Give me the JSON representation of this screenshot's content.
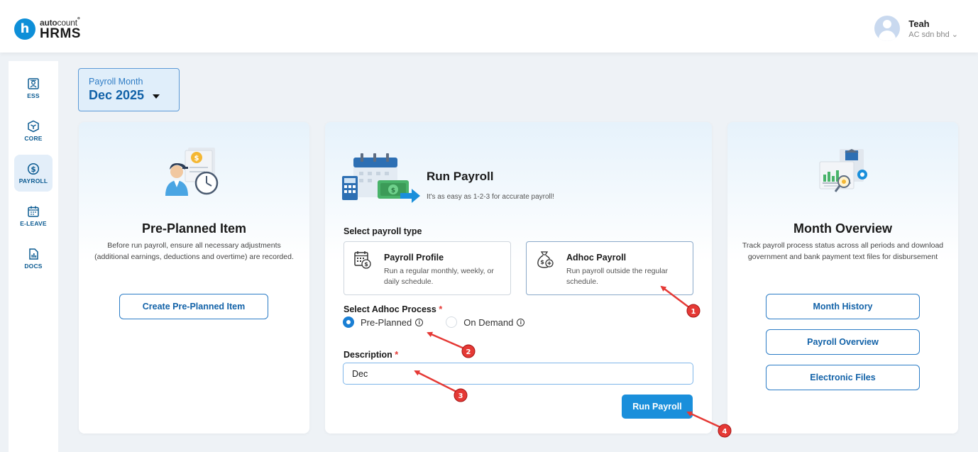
{
  "header": {
    "logo_small_bold": "auto",
    "logo_small_thin": "count",
    "logo_mark": "°",
    "logo_big": "HRMS",
    "logo_badge": "h",
    "user_name": "Teah",
    "user_company": "AC sdn bhd ⌄"
  },
  "sidebar": {
    "items": [
      {
        "label": "ESS",
        "icon": "ess-icon"
      },
      {
        "label": "CORE",
        "icon": "cube-icon"
      },
      {
        "label": "PAYROLL",
        "icon": "dollar-icon"
      },
      {
        "label": "E-LEAVE",
        "icon": "calendar-icon"
      },
      {
        "label": "DOCS",
        "icon": "docs-icon"
      }
    ],
    "active": "PAYROLL"
  },
  "payroll_month": {
    "label": "Payroll Month",
    "value": "Dec 2025"
  },
  "pre_planned": {
    "title": "Pre-Planned Item",
    "description": "Before run payroll, ensure all necessary adjustments (additional earnings, deductions and overtime) are recorded.",
    "button": "Create Pre-Planned Item"
  },
  "run_payroll": {
    "title": "Run Payroll",
    "subtitle": "It's as easy as 1-2-3 for accurate payroll!",
    "select_type_label": "Select payroll type",
    "types": [
      {
        "title": "Payroll Profile",
        "description": "Run a regular monthly, weekly, or daily schedule."
      },
      {
        "title": "Adhoc Payroll",
        "description": "Run payroll outside the regular schedule."
      }
    ],
    "adhoc_label": "Select Adhoc Process",
    "required_mark": "*",
    "options": [
      "Pre-Planned",
      "On Demand"
    ],
    "selected_option": "Pre-Planned",
    "info_glyph": "i",
    "description_label": "Description",
    "description_value": "Dec",
    "button": "Run Payroll"
  },
  "month_overview": {
    "title": "Month Overview",
    "description": "Track payroll process status across all periods and download government and bank payment text files for disbursement",
    "buttons": [
      "Month History",
      "Payroll Overview",
      "Electronic Files"
    ]
  },
  "annotations": [
    "1",
    "2",
    "3",
    "4"
  ],
  "colors": {
    "brand": "#0e8fd8",
    "primary": "#1a8fdb",
    "annotation": "#e53935"
  }
}
